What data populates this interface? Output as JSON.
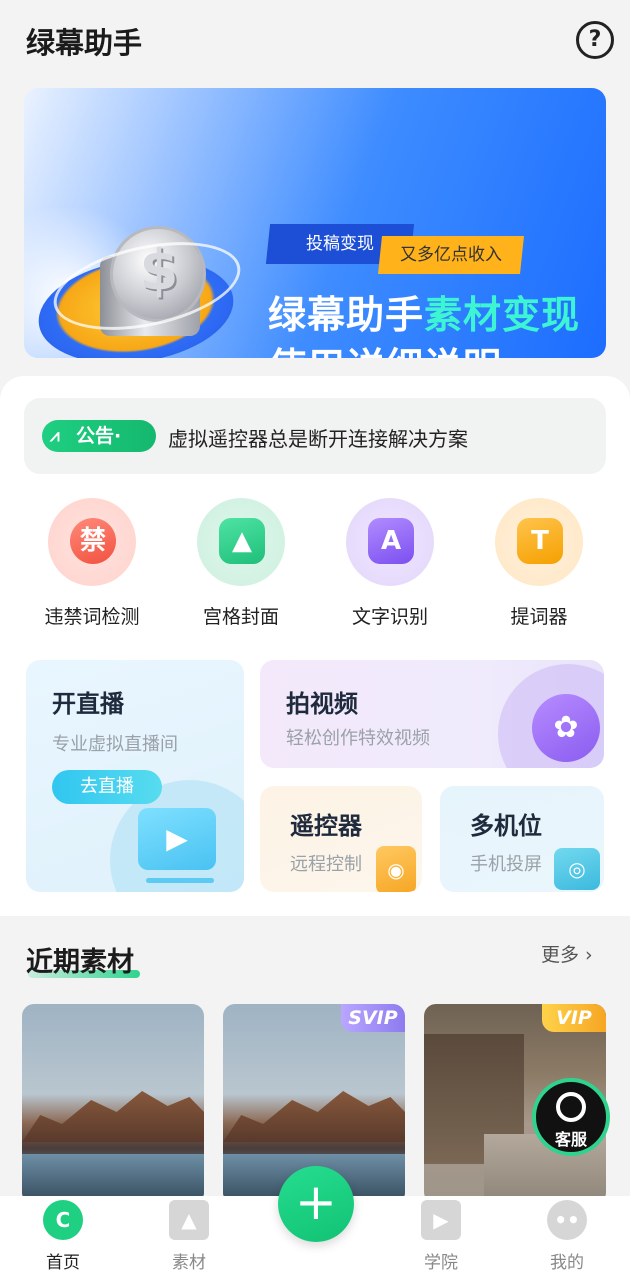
{
  "header": {
    "title": "绿幕助手",
    "help_icon": "question-circle-icon",
    "help_symbol": "?"
  },
  "banner": {
    "tag_left": "投稿变现",
    "tag_right": "又多亿点收入",
    "line1_part1": "绿幕助手",
    "line1_highlight": "素材变现",
    "line2": "使用详细说明",
    "highlight_color": "#3df5d2",
    "coin_symbol": "$"
  },
  "notice": {
    "badge": "公告",
    "text": "虚拟遥控器总是断开连接解决方案"
  },
  "tools": [
    {
      "label": "违禁词检测",
      "icon": "forbidden-words-icon",
      "glyph": "禁"
    },
    {
      "label": "宫格封面",
      "icon": "grid-cover-icon",
      "glyph": "▲"
    },
    {
      "label": "文字识别",
      "icon": "text-recognition-icon",
      "glyph": "A"
    },
    {
      "label": "提词器",
      "icon": "teleprompter-icon",
      "glyph": "T"
    }
  ],
  "features": {
    "live": {
      "title": "开直播",
      "subtitle": "专业虚拟直播间",
      "button": "去直播"
    },
    "video": {
      "title": "拍视频",
      "subtitle": "轻松创作特效视频"
    },
    "remote": {
      "title": "遥控器",
      "subtitle": "远程控制"
    },
    "multi": {
      "title": "多机位",
      "subtitle": "手机投屏"
    }
  },
  "recent": {
    "title": "近期素材",
    "more": "更多 ›",
    "items": [
      {
        "scene": "mountain-lake",
        "badge": ""
      },
      {
        "scene": "mountain-lake",
        "badge": "SVIP"
      },
      {
        "scene": "village-street",
        "badge": "VIP"
      }
    ]
  },
  "customer_service": {
    "label": "客服",
    "icon": "headset-icon"
  },
  "bottom_nav": {
    "items": [
      {
        "label": "首页",
        "icon": "home-icon",
        "active": true
      },
      {
        "label": "素材",
        "icon": "image-icon",
        "active": false
      },
      {
        "label": "学院",
        "icon": "play-icon",
        "active": false
      },
      {
        "label": "我的",
        "icon": "profile-icon",
        "active": false
      }
    ],
    "fab_symbol": "+",
    "fab_icon": "plus-icon",
    "ghost_text": "素"
  },
  "colors": {
    "accent_green": "#1fcf82",
    "banner_blue": "#1c6dff",
    "vip_gold": "#f6a623",
    "svip_purple": "#8e7bf0"
  }
}
